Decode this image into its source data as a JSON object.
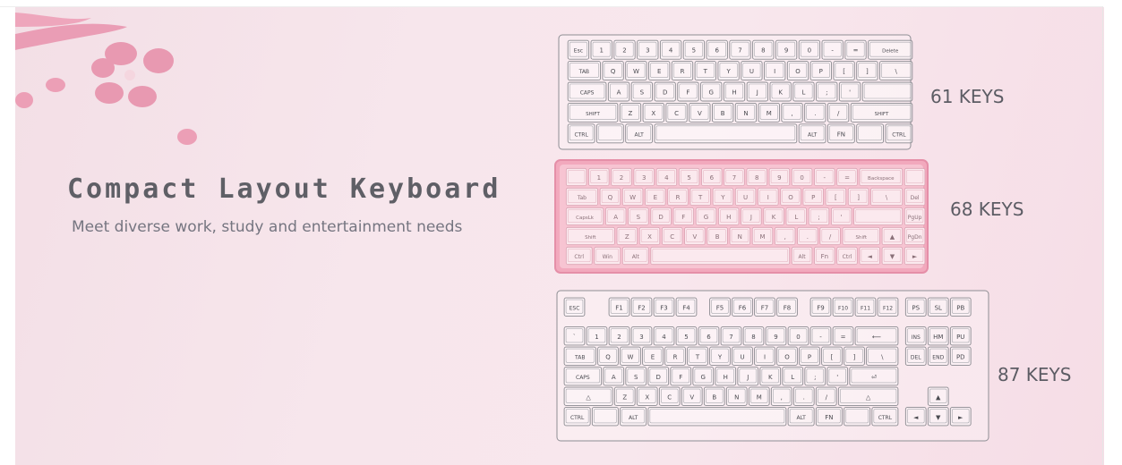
{
  "banner": {
    "title": "Compact Layout Keyboard",
    "subtitle": "Meet diverse work, study and entertainment needs",
    "colors": {
      "background": "#f7e4ea",
      "flower": "#e79bb3",
      "title": "#5f5f66",
      "outline": "#8e8e94",
      "pink_case": "#f2a9bd"
    }
  },
  "keyboards": [
    {
      "label": "61 KEYS",
      "style": "outline",
      "rows": [
        [
          [
            "Esc",
            1
          ],
          [
            "1",
            1
          ],
          [
            "2",
            1
          ],
          [
            "3",
            1
          ],
          [
            "4",
            1
          ],
          [
            "5",
            1
          ],
          [
            "6",
            1
          ],
          [
            "7",
            1
          ],
          [
            "8",
            1
          ],
          [
            "9",
            1
          ],
          [
            "0",
            1
          ],
          [
            "-",
            1
          ],
          [
            "=",
            1
          ],
          [
            "Delete",
            2
          ]
        ],
        [
          [
            "TAB",
            1.5
          ],
          [
            "Q",
            1
          ],
          [
            "W",
            1
          ],
          [
            "E",
            1
          ],
          [
            "R",
            1
          ],
          [
            "T",
            1
          ],
          [
            "Y",
            1
          ],
          [
            "U",
            1
          ],
          [
            "I",
            1
          ],
          [
            "O",
            1
          ],
          [
            "P",
            1
          ],
          [
            "[",
            1
          ],
          [
            "]",
            1
          ],
          [
            "\\",
            1.5
          ]
        ],
        [
          [
            "CAPS",
            1.75
          ],
          [
            "A",
            1
          ],
          [
            "S",
            1
          ],
          [
            "D",
            1
          ],
          [
            "F",
            1
          ],
          [
            "G",
            1
          ],
          [
            "H",
            1
          ],
          [
            "J",
            1
          ],
          [
            "K",
            1
          ],
          [
            "L",
            1
          ],
          [
            ";",
            1
          ],
          [
            "'",
            1
          ],
          [
            "",
            2.25
          ]
        ],
        [
          [
            "SHIFT",
            2.25
          ],
          [
            "Z",
            1
          ],
          [
            "X",
            1
          ],
          [
            "C",
            1
          ],
          [
            "V",
            1
          ],
          [
            "B",
            1
          ],
          [
            "N",
            1
          ],
          [
            "M",
            1
          ],
          [
            ",",
            1
          ],
          [
            ".",
            1
          ],
          [
            "/",
            1
          ],
          [
            "SHIFT",
            2.75
          ]
        ],
        [
          [
            "CTRL",
            1.25
          ],
          [
            "",
            1.25
          ],
          [
            "ALT",
            1.25
          ],
          [
            "",
            6.25
          ],
          [
            "ALT",
            1.25
          ],
          [
            "FN",
            1.25
          ],
          [
            "",
            1.25
          ],
          [
            "CTRL",
            1.25
          ]
        ]
      ]
    },
    {
      "label": "68 KEYS",
      "style": "pink",
      "rows": [
        [
          [
            "",
            1
          ],
          [
            "1",
            1
          ],
          [
            "2",
            1
          ],
          [
            "3",
            1
          ],
          [
            "4",
            1
          ],
          [
            "5",
            1
          ],
          [
            "6",
            1
          ],
          [
            "7",
            1
          ],
          [
            "8",
            1
          ],
          [
            "9",
            1
          ],
          [
            "0",
            1
          ],
          [
            "-",
            1
          ],
          [
            "=",
            1
          ],
          [
            "Backspace",
            2
          ],
          [
            "",
            1
          ]
        ],
        [
          [
            "Tab",
            1.5
          ],
          [
            "Q",
            1
          ],
          [
            "W",
            1
          ],
          [
            "E",
            1
          ],
          [
            "R",
            1
          ],
          [
            "T",
            1
          ],
          [
            "Y",
            1
          ],
          [
            "U",
            1
          ],
          [
            "I",
            1
          ],
          [
            "O",
            1
          ],
          [
            "P",
            1
          ],
          [
            "[",
            1
          ],
          [
            "]",
            1
          ],
          [
            "\\",
            1.5
          ],
          [
            "Del",
            1
          ]
        ],
        [
          [
            "CapsLk",
            1.75
          ],
          [
            "A",
            1
          ],
          [
            "S",
            1
          ],
          [
            "D",
            1
          ],
          [
            "F",
            1
          ],
          [
            "G",
            1
          ],
          [
            "H",
            1
          ],
          [
            "J",
            1
          ],
          [
            "K",
            1
          ],
          [
            "L",
            1
          ],
          [
            ";",
            1
          ],
          [
            "'",
            1
          ],
          [
            "",
            2.25
          ],
          [
            "PgUp",
            1
          ]
        ],
        [
          [
            "Shift",
            2.25
          ],
          [
            "Z",
            1
          ],
          [
            "X",
            1
          ],
          [
            "C",
            1
          ],
          [
            "V",
            1
          ],
          [
            "B",
            1
          ],
          [
            "N",
            1
          ],
          [
            "M",
            1
          ],
          [
            ",",
            1
          ],
          [
            ".",
            1
          ],
          [
            "/",
            1
          ],
          [
            "Shift",
            1.75
          ],
          [
            "▲",
            1
          ],
          [
            "PgDn",
            1
          ]
        ],
        [
          [
            "Ctrl",
            1.25
          ],
          [
            "Win",
            1.25
          ],
          [
            "Alt",
            1.25
          ],
          [
            "",
            6.25
          ],
          [
            "Alt",
            1
          ],
          [
            "Fn",
            1
          ],
          [
            "Ctrl",
            1
          ],
          [
            "◄",
            1
          ],
          [
            "▼",
            1
          ],
          [
            "►",
            1
          ]
        ]
      ]
    },
    {
      "label": "87 KEYS",
      "style": "outline",
      "rows": [
        [
          [
            "ESC",
            1
          ],
          [
            "",
            1
          ],
          [
            "F1",
            1
          ],
          [
            "F2",
            1
          ],
          [
            "F3",
            1
          ],
          [
            "F4",
            1
          ],
          [
            "",
            0.5
          ],
          [
            "F5",
            1
          ],
          [
            "F6",
            1
          ],
          [
            "F7",
            1
          ],
          [
            "F8",
            1
          ],
          [
            "",
            0.5
          ],
          [
            "F9",
            1
          ],
          [
            "F10",
            1
          ],
          [
            "F11",
            1
          ],
          [
            "F12",
            1
          ],
          [
            "",
            0.25
          ],
          [
            "PS",
            1
          ],
          [
            "SL",
            1
          ],
          [
            "PB",
            1
          ]
        ],
        [
          [
            "",
            0
          ],
          [
            "",
            0
          ]
        ],
        [
          [
            "`",
            1
          ],
          [
            "1",
            1
          ],
          [
            "2",
            1
          ],
          [
            "3",
            1
          ],
          [
            "4",
            1
          ],
          [
            "5",
            1
          ],
          [
            "6",
            1
          ],
          [
            "7",
            1
          ],
          [
            "8",
            1
          ],
          [
            "9",
            1
          ],
          [
            "0",
            1
          ],
          [
            "-",
            1
          ],
          [
            "=",
            1
          ],
          [
            "⟵",
            2
          ],
          [
            "",
            0.25
          ],
          [
            "INS",
            1
          ],
          [
            "HM",
            1
          ],
          [
            "PU",
            1
          ]
        ],
        [
          [
            "TAB",
            1.5
          ],
          [
            "Q",
            1
          ],
          [
            "W",
            1
          ],
          [
            "E",
            1
          ],
          [
            "R",
            1
          ],
          [
            "T",
            1
          ],
          [
            "Y",
            1
          ],
          [
            "U",
            1
          ],
          [
            "I",
            1
          ],
          [
            "O",
            1
          ],
          [
            "P",
            1
          ],
          [
            "[",
            1
          ],
          [
            "]",
            1
          ],
          [
            "\\",
            1.5
          ],
          [
            "",
            0.25
          ],
          [
            "DEL",
            1
          ],
          [
            "END",
            1
          ],
          [
            "PD",
            1
          ]
        ],
        [
          [
            "CAPS",
            1.75
          ],
          [
            "A",
            1
          ],
          [
            "S",
            1
          ],
          [
            "D",
            1
          ],
          [
            "F",
            1
          ],
          [
            "G",
            1
          ],
          [
            "H",
            1
          ],
          [
            "J",
            1
          ],
          [
            "K",
            1
          ],
          [
            "L",
            1
          ],
          [
            ";",
            1
          ],
          [
            "'",
            1
          ],
          [
            "⏎",
            2.25
          ],
          [
            "",
            3.25
          ]
        ],
        [
          [
            "△",
            2.25
          ],
          [
            "Z",
            1
          ],
          [
            "X",
            1
          ],
          [
            "C",
            1
          ],
          [
            "V",
            1
          ],
          [
            "B",
            1
          ],
          [
            "N",
            1
          ],
          [
            "M",
            1
          ],
          [
            ",",
            1
          ],
          [
            ".",
            1
          ],
          [
            "/",
            1
          ],
          [
            "△",
            2.75
          ],
          [
            "",
            1.25
          ],
          [
            "▲",
            1
          ],
          [
            "",
            1
          ]
        ],
        [
          [
            "CTRL",
            1.25
          ],
          [
            "",
            1.25
          ],
          [
            "ALT",
            1.25
          ],
          [
            "",
            6.25
          ],
          [
            "ALT",
            1.25
          ],
          [
            "FN",
            1.25
          ],
          [
            "",
            1.25
          ],
          [
            "CTRL",
            1.25
          ],
          [
            "",
            0.25
          ],
          [
            "◄",
            1
          ],
          [
            "▼",
            1
          ],
          [
            "►",
            1
          ]
        ]
      ]
    }
  ]
}
